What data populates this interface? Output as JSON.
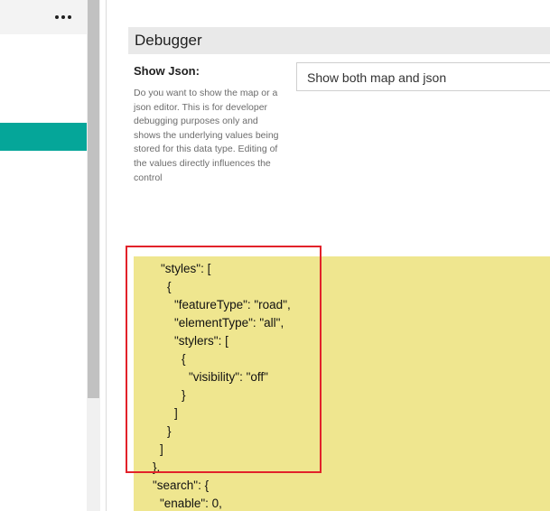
{
  "sidebar": {
    "more_label": "More options"
  },
  "debugger": {
    "section_title": "Debugger",
    "field_label": "Show Json:",
    "field_description": "Do you want to show the map or a json editor. This is for developer debugging purposes only and shows the underlying values being stored for this data type. Editing of the values directly influences the control",
    "select_value": "Show both map and json"
  },
  "json_editor": {
    "lines": [
      "\"styles\": [",
      "{",
      "\"featureType\": \"road\",",
      "\"elementType\": \"all\",",
      "\"stylers\": [",
      "{",
      "\"visibility\": \"off\"",
      "}",
      "]",
      "}",
      "]",
      "},",
      "\"search\": {",
      "\"enable\": 0,"
    ]
  },
  "colors": {
    "accent": "#05a699",
    "editor_background": "#efe68f",
    "highlight": "#e2222a"
  }
}
